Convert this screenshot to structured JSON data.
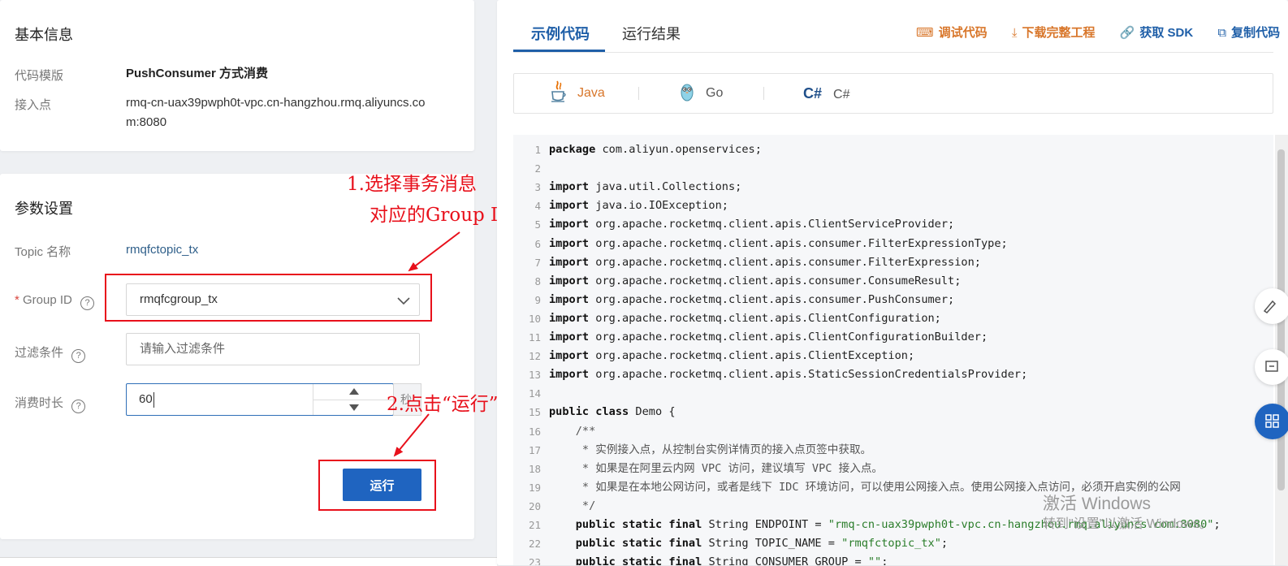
{
  "basic_info": {
    "title": "基本信息",
    "template_label": "代码模版",
    "template_value": "PushConsumer 方式消费",
    "endpoint_label": "接入点",
    "endpoint_value_line1": "rmq-cn-uax39pwph0t-vpc.cn-hangzhou.rmq.aliyuncs.co",
    "endpoint_value_line2": "m:8080"
  },
  "params": {
    "title": "参数设置",
    "topic_label": "Topic 名称",
    "topic_value": "rmqfctopic_tx",
    "group_required_mark": "*",
    "group_label": "Group ID",
    "group_value": "rmqfcgroup_tx",
    "filter_label": "过滤条件",
    "filter_placeholder": "请输入过滤条件",
    "duration_label": "消费时长",
    "duration_value": "60",
    "duration_unit": "秒",
    "help_glyph": "?",
    "run_label": "运行"
  },
  "annotations": {
    "step1_line1": "1.选择事务消息",
    "step1_line2": "对应的Group ID",
    "step2": "2.点击“运行”",
    "color": "#e8101b"
  },
  "code_panel": {
    "tabs": [
      {
        "label": "示例代码",
        "active": true
      },
      {
        "label": "运行结果",
        "active": false
      }
    ],
    "actions": [
      {
        "icon": "debug-icon",
        "glyph": "⌨",
        "label": "调试代码",
        "color": "#d8762a"
      },
      {
        "icon": "download-icon",
        "glyph": "⤓",
        "label": "下载完整工程",
        "color": "#d8762a"
      },
      {
        "icon": "link-icon",
        "glyph": "🔗",
        "label": "获取 SDK",
        "color": "#1f5fa8"
      },
      {
        "icon": "copy-icon",
        "glyph": "⧉",
        "label": "复制代码",
        "color": "#1f5fa8"
      }
    ],
    "languages": [
      {
        "icon": "java-cup-icon",
        "label": "Java",
        "active": true
      },
      {
        "icon": "go-gopher-icon",
        "label": "Go",
        "active": false
      },
      {
        "icon": "csharp-icon",
        "icon_text": "C#",
        "label": "C#",
        "active": false
      }
    ],
    "code_lines": [
      {
        "n": "1",
        "t": "package com.aliyun.openservices;"
      },
      {
        "n": "2",
        "t": ""
      },
      {
        "n": "3",
        "t": "import java.util.Collections;"
      },
      {
        "n": "4",
        "t": "import java.io.IOException;"
      },
      {
        "n": "5",
        "t": "import org.apache.rocketmq.client.apis.ClientServiceProvider;"
      },
      {
        "n": "6",
        "t": "import org.apache.rocketmq.client.apis.consumer.FilterExpressionType;"
      },
      {
        "n": "7",
        "t": "import org.apache.rocketmq.client.apis.consumer.FilterExpression;"
      },
      {
        "n": "8",
        "t": "import org.apache.rocketmq.client.apis.consumer.ConsumeResult;"
      },
      {
        "n": "9",
        "t": "import org.apache.rocketmq.client.apis.consumer.PushConsumer;"
      },
      {
        "n": "10",
        "t": "import org.apache.rocketmq.client.apis.ClientConfiguration;"
      },
      {
        "n": "11",
        "t": "import org.apache.rocketmq.client.apis.ClientConfigurationBuilder;"
      },
      {
        "n": "12",
        "t": "import org.apache.rocketmq.client.apis.ClientException;"
      },
      {
        "n": "13",
        "t": "import org.apache.rocketmq.client.apis.StaticSessionCredentialsProvider;"
      },
      {
        "n": "14",
        "t": ""
      },
      {
        "n": "15",
        "t": "public class Demo {"
      },
      {
        "n": "16",
        "t": "    /**"
      },
      {
        "n": "17",
        "t": "     * 实例接入点，从控制台实例详情页的接入点页签中获取。"
      },
      {
        "n": "18",
        "t": "     * 如果是在阿里云内网 VPC 访问，建议填写 VPC 接入点。"
      },
      {
        "n": "19",
        "t": "     * 如果是在本地公网访问，或者是线下 IDC 环境访问，可以使用公网接入点。使用公网接入点访问，必须开启实例的公网"
      },
      {
        "n": "20",
        "t": "     */"
      },
      {
        "n": "21",
        "t": "    public static final String ENDPOINT = \"rmq-cn-uax39pwph0t-vpc.cn-hangzhou.rmq.aliyuncs.com:8080\";"
      },
      {
        "n": "22",
        "t": "    public static final String TOPIC_NAME = \"rmqfctopic_tx\";"
      },
      {
        "n": "23",
        "t": "    public static final String CONSUMER_GROUP = \"\";"
      }
    ]
  },
  "watermark": {
    "line1": "激活 Windows",
    "line2": "转到\"设置\"以激活 Windows。"
  }
}
